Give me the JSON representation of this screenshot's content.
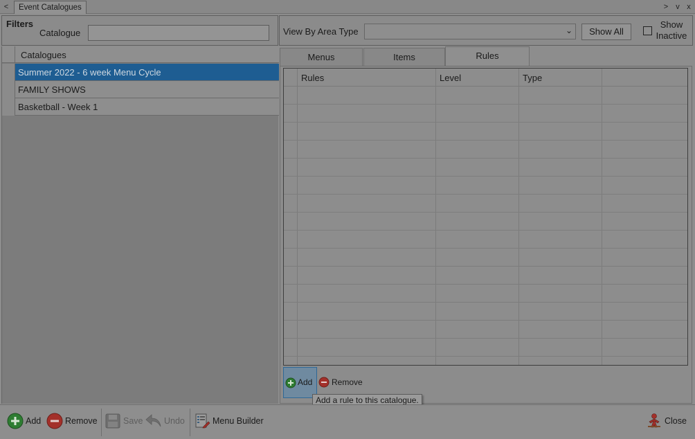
{
  "tabstrip": {
    "nav_prev": "<",
    "doc_tab": "Event Catalogues",
    "nav_next": ">",
    "nav_down": "v",
    "nav_close": "x"
  },
  "filters": {
    "title": "Filters",
    "catalogue_label": "Catalogue",
    "catalogue_value": ""
  },
  "viewby": {
    "label": "View By Area Type",
    "selected": "",
    "show_all": "Show All",
    "show_inactive": "Show Inactive",
    "show_inactive_checked": false
  },
  "catalogues": {
    "header": "Catalogues",
    "rows": [
      {
        "name": "Summer 2022 - 6 week Menu Cycle",
        "selected": true
      },
      {
        "name": "FAMILY SHOWS",
        "selected": false
      },
      {
        "name": "Basketball - Week 1",
        "selected": false
      }
    ]
  },
  "detail_tabs": {
    "menus": "Menus",
    "items": "Items",
    "rules": "Rules",
    "active": "Rules"
  },
  "rules_grid": {
    "columns": [
      "Rules",
      "Level",
      "Type"
    ],
    "rows": []
  },
  "rule_actions": {
    "add": "Add",
    "remove": "Remove",
    "tooltip": "Add a rule to this catalogue."
  },
  "toolbar": {
    "add": "Add",
    "remove": "Remove",
    "save": "Save",
    "undo": "Undo",
    "menu_builder": "Menu Builder",
    "close": "Close"
  },
  "colors": {
    "selection": "#1e5d92",
    "add_green": "#2e7d32",
    "remove_red": "#a3302a"
  },
  "icons": [
    "plus-circle-icon",
    "minus-circle-icon",
    "save-disk-icon",
    "undo-arrow-icon",
    "menu-builder-icon",
    "close-figure-icon",
    "chevron-down-icon"
  ]
}
